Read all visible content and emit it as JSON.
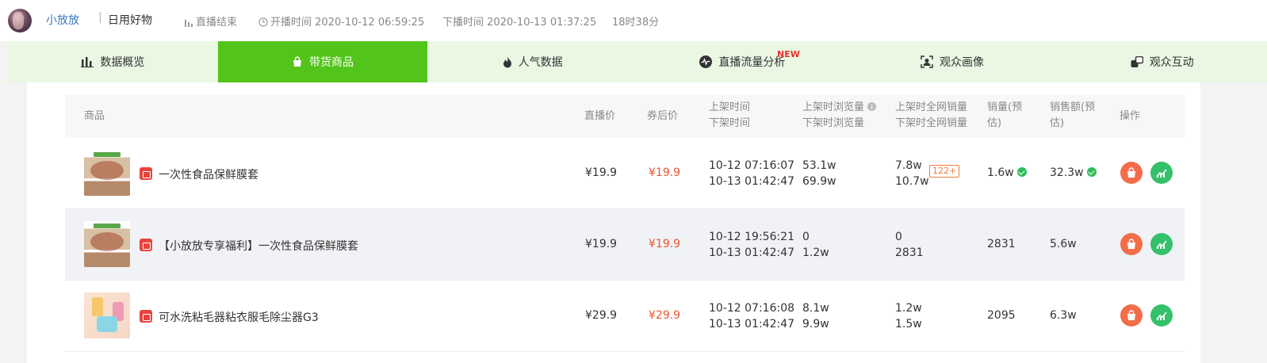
{
  "header": {
    "anchor_name": "小放放",
    "category": "日用好物",
    "status": "直播结束",
    "start_label": "开播时间",
    "start_time": "2020-10-12 06:59:25",
    "end_label": "下播时间",
    "end_time": "2020-10-13 01:37:25",
    "duration": "18时38分"
  },
  "tabs": [
    {
      "label": "数据概览",
      "icon": "bar-chart-icon"
    },
    {
      "label": "带货商品",
      "icon": "shopping-bag-icon",
      "active": true
    },
    {
      "label": "人气数据",
      "icon": "flame-icon"
    },
    {
      "label": "直播流量分析",
      "icon": "pulse-icon",
      "badge": "NEW"
    },
    {
      "label": "观众画像",
      "icon": "user-frame-icon"
    },
    {
      "label": "观众互动",
      "icon": "chat-icon"
    }
  ],
  "table": {
    "headers": {
      "product": "商品",
      "live_price": "直播价",
      "coupon_price": "券后价",
      "shelf_time": "上架时间",
      "off_time": "下架时间",
      "shelf_views": "上架时浏览量",
      "off_views": "下架时浏览量",
      "shelf_sales": "上架时全网销量",
      "off_sales": "下架时全网销量",
      "sales_line1": "销量(预",
      "sales_line2": "估)",
      "revenue_line1": "销售额(预",
      "revenue_line2": "估)",
      "actions": "操作"
    },
    "rows": [
      {
        "title": "一次性食品保鲜膜套",
        "live_price": "¥19.9",
        "coupon_price": "¥19.9",
        "shelf_time": "10-12 07:16:07",
        "off_time": "10-13 01:42:47",
        "shelf_views": "53.1w",
        "off_views": "69.9w",
        "shelf_sales": "7.8w",
        "off_sales": "10.7w",
        "growth_badge": "122+",
        "sales": "1.6w",
        "revenue": "32.3w"
      },
      {
        "title": "【小放放专享福利】一次性食品保鲜膜套",
        "live_price": "¥19.9",
        "coupon_price": "¥19.9",
        "shelf_time": "10-12 19:56:21",
        "off_time": "10-13 01:42:47",
        "shelf_views": "0",
        "off_views": "1.2w",
        "shelf_sales": "0",
        "off_sales": "2831",
        "sales": "2831",
        "revenue": "5.6w"
      },
      {
        "title": "可水洗粘毛器粘衣服毛除尘器G3",
        "live_price": "¥29.9",
        "coupon_price": "¥29.9",
        "shelf_time": "10-12 07:16:08",
        "off_time": "10-13 01:42:47",
        "shelf_views": "8.1w",
        "off_views": "9.9w",
        "shelf_sales": "1.2w",
        "off_sales": "1.5w",
        "sales": "2095",
        "revenue": "6.3w"
      }
    ]
  }
}
